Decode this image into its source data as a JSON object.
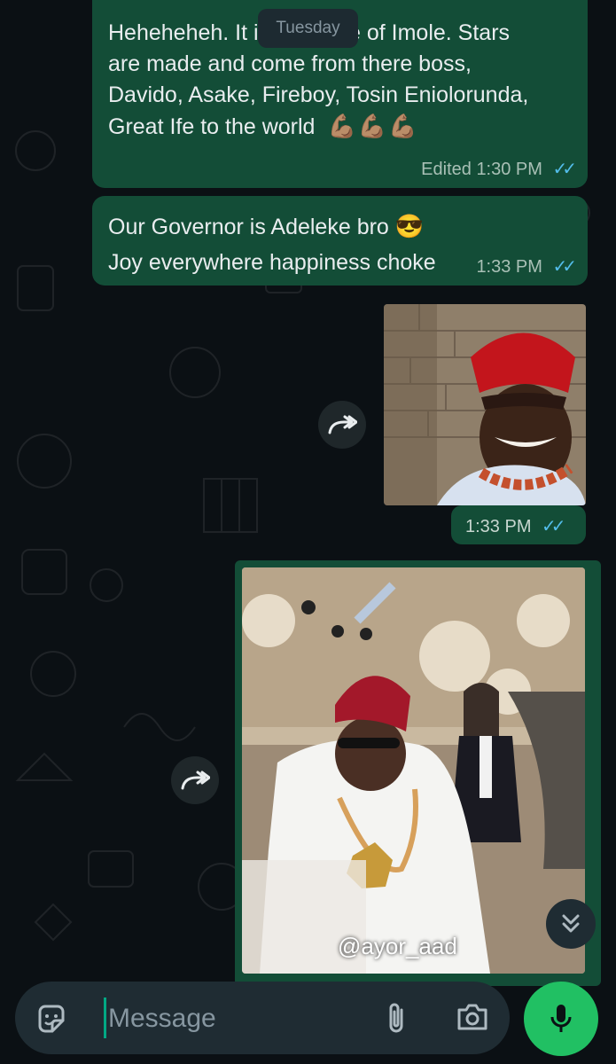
{
  "chat": {
    "date_divider": "Tuesday",
    "messages": [
      {
        "text": "Heheheheh. It is the state of Imole. Stars\nare made and  come from there boss,\nDavido, Asake, Fireboy, Tosin Eniolorunda,\nGreat Ife to the world",
        "emoji": "💪🏽💪🏽💪🏽",
        "edited_label": "Edited",
        "time": "1:30 PM"
      },
      {
        "text_before": "Our Governor is Adeleke bro",
        "emoji": "😎",
        "text_after": "Joy everywhere happiness choke",
        "time": "1:33 PM"
      },
      {
        "type": "image",
        "time": "1:33 PM"
      },
      {
        "type": "video",
        "watermark": "@ayor_aad"
      }
    ]
  },
  "composer": {
    "placeholder": "Message"
  },
  "icons": {
    "forward": "forward-icon",
    "scroll": "chevrons-down-icon",
    "emoji": "sticker-icon",
    "attach": "paperclip-icon",
    "camera": "camera-icon",
    "mic": "mic-icon"
  },
  "colors": {
    "background": "#0b1014",
    "outgoing_bubble": "#134d37",
    "read_ticks": "#53bdeb",
    "accent": "#21c063"
  }
}
